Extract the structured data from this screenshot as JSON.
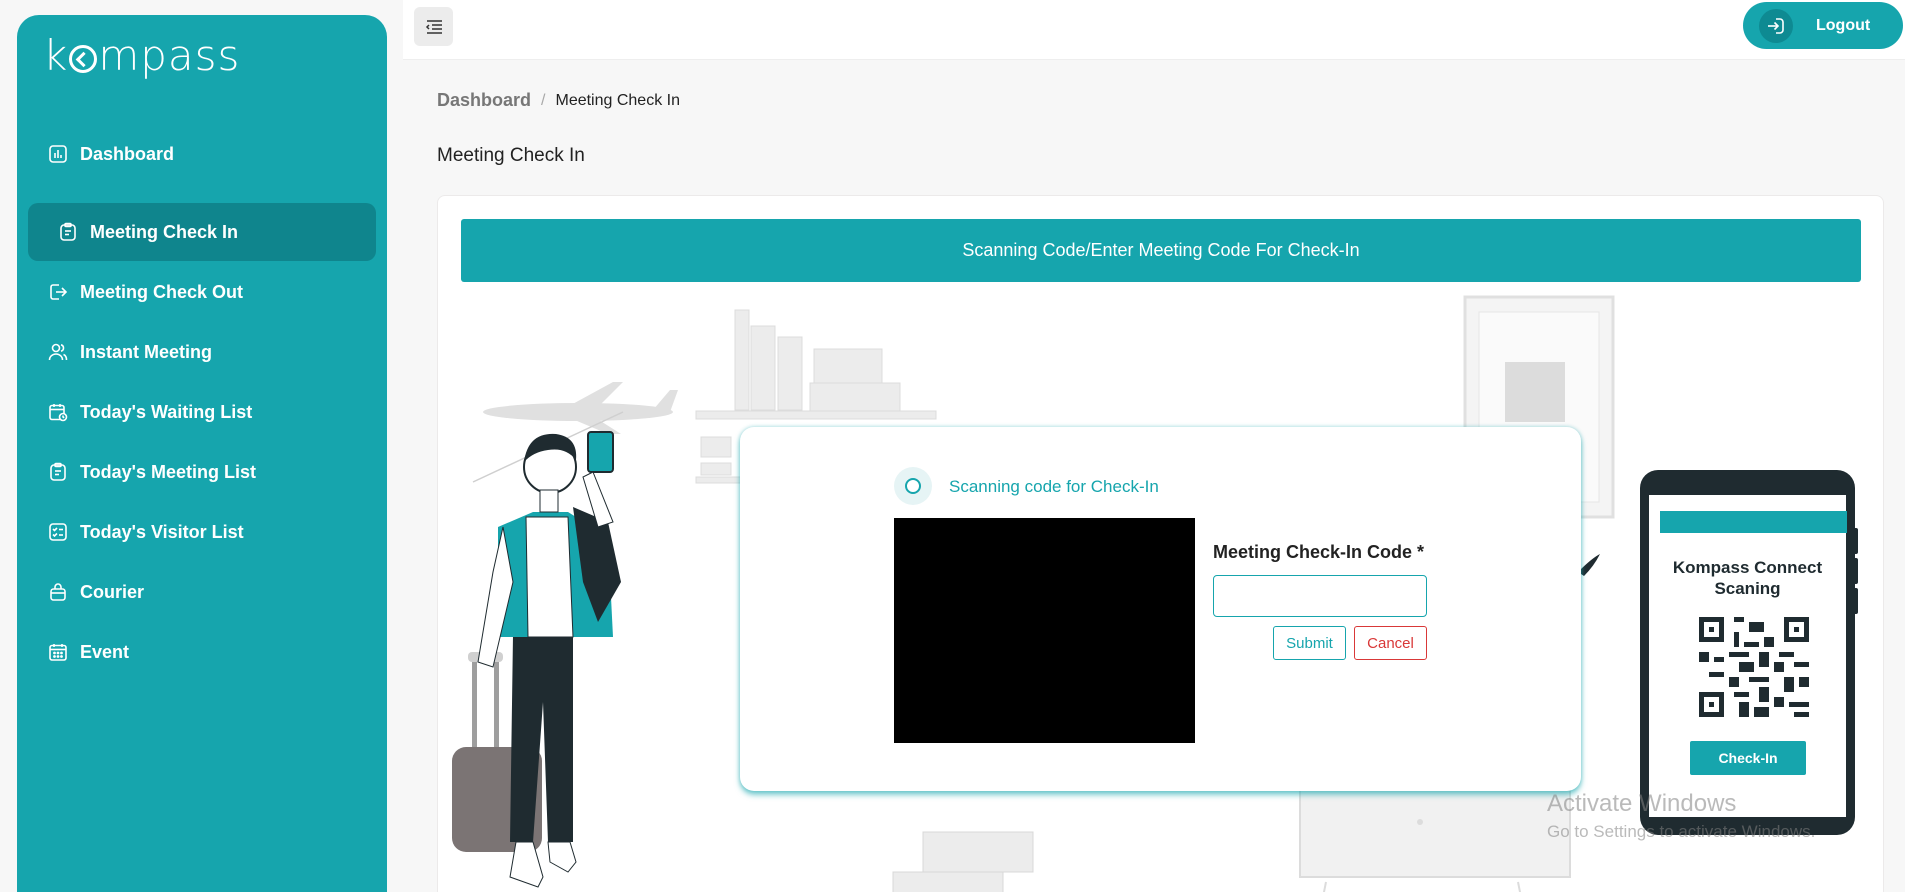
{
  "brand": {
    "logo_text_1": "k",
    "logo_text_2": "mpass"
  },
  "sidebar": {
    "items": [
      {
        "label": "Dashboard",
        "icon": "chart-icon"
      },
      {
        "label": "Meeting Check In",
        "icon": "clipboard-icon",
        "active": true
      },
      {
        "label": "Meeting Check Out",
        "icon": "exit-icon"
      },
      {
        "label": "Instant Meeting",
        "icon": "users-icon"
      },
      {
        "label": "Today's Waiting List",
        "icon": "calendar-clock-icon"
      },
      {
        "label": "Today's Meeting List",
        "icon": "clipboard-list-icon"
      },
      {
        "label": "Today's Visitor List",
        "icon": "checklist-icon"
      },
      {
        "label": "Courier",
        "icon": "bag-icon"
      },
      {
        "label": "Event",
        "icon": "calendar-icon"
      }
    ]
  },
  "topbar": {
    "logout_label": "Logout"
  },
  "breadcrumb": {
    "home": "Dashboard",
    "separator": "/",
    "current": "Meeting Check In"
  },
  "page": {
    "title": "Meeting Check In",
    "card_header": "Scanning Code/Enter Meeting Code For Check-In"
  },
  "modal": {
    "scan_label": "Scanning code for Check-In",
    "code_label": "Meeting Check-In Code *",
    "code_value": "",
    "submit_label": "Submit",
    "cancel_label": "Cancel"
  },
  "phone": {
    "title_line1": "Kompass Connect",
    "title_line2": "Scaning",
    "button_label": "Check-In"
  },
  "watermark": {
    "title": "Activate Windows",
    "subtitle": "Go to Settings to activate Windows."
  },
  "colors": {
    "primary": "#16a5ad",
    "primary_dark": "#0f858d",
    "danger": "#d93838",
    "ink": "#1f2b30"
  }
}
